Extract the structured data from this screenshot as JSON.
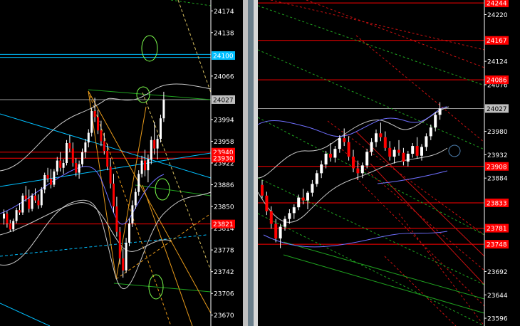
{
  "colors": {
    "background": "#000000",
    "bull_candle": "#ffffff",
    "bear_candle": "#ff0000",
    "wick": "#ffffff",
    "axis_text": "#ffffff",
    "price_line": "#ffffff",
    "level_line": "#ff0000",
    "label_red": "#ff0000",
    "label_cyan": "#00bfff",
    "label_gray": "#bfbfbf",
    "ma": "#6f6fff",
    "envelope": "#c8c8c8",
    "cyan_line": "#00bfff",
    "green_line": "#1fa31f",
    "orange_line": "#e89a1a",
    "yellow_line": "#d8c060",
    "circle": "#7cfc4c"
  },
  "chart_data": [
    {
      "type": "candlestick",
      "ylim": [
        23652,
        24192
      ],
      "y_ticks": [
        "24174",
        "24138",
        "24066",
        "23994",
        "23958",
        "23922",
        "23886",
        "23850",
        "23814",
        "23778",
        "23742",
        "23706",
        "23670"
      ],
      "price_labels": [
        {
          "text": "24100",
          "value": 24100,
          "color": "cyan"
        },
        {
          "text": "24027",
          "value": 24027,
          "color": "gray"
        },
        {
          "text": "23940",
          "value": 23940,
          "color": "red"
        },
        {
          "text": "23930",
          "value": 23930,
          "color": "red"
        },
        {
          "text": "23821",
          "value": 23821,
          "color": "red"
        }
      ],
      "current_price": 24027,
      "red_levels": [
        23940,
        23930,
        23821
      ],
      "candles": [
        [
          23830,
          23845,
          23820,
          23838
        ],
        [
          23838,
          23842,
          23815,
          23822
        ],
        [
          23822,
          23828,
          23808,
          23812
        ],
        [
          23812,
          23830,
          23808,
          23826
        ],
        [
          23826,
          23848,
          23822,
          23844
        ],
        [
          23844,
          23856,
          23836,
          23840
        ],
        [
          23840,
          23872,
          23836,
          23868
        ],
        [
          23868,
          23884,
          23858,
          23862
        ],
        [
          23862,
          23878,
          23840,
          23846
        ],
        [
          23846,
          23872,
          23842,
          23868
        ],
        [
          23868,
          23880,
          23856,
          23860
        ],
        [
          23860,
          23870,
          23846,
          23852
        ],
        [
          23852,
          23882,
          23848,
          23878
        ],
        [
          23878,
          23906,
          23872,
          23902
        ],
        [
          23902,
          23914,
          23890,
          23896
        ],
        [
          23896,
          23912,
          23880,
          23886
        ],
        [
          23886,
          23912,
          23882,
          23908
        ],
        [
          23908,
          23932,
          23902,
          23926
        ],
        [
          23926,
          23940,
          23908,
          23914
        ],
        [
          23914,
          23928,
          23904,
          23922
        ],
        [
          23922,
          23960,
          23918,
          23955
        ],
        [
          23955,
          23968,
          23940,
          23946
        ],
        [
          23946,
          23956,
          23916,
          23922
        ],
        [
          23922,
          23930,
          23900,
          23906
        ],
        [
          23906,
          23926,
          23896,
          23920
        ],
        [
          23920,
          23946,
          23916,
          23940
        ],
        [
          23940,
          23962,
          23930,
          23956
        ],
        [
          23956,
          23978,
          23948,
          23972
        ],
        [
          23972,
          24014,
          23966,
          24008
        ],
        [
          24008,
          24030,
          23990,
          23998
        ],
        [
          23998,
          24010,
          23970,
          23976
        ],
        [
          23976,
          23992,
          23950,
          23958
        ],
        [
          23958,
          23972,
          23936,
          23942
        ],
        [
          23942,
          23954,
          23910,
          23916
        ],
        [
          23916,
          23930,
          23880,
          23888
        ],
        [
          23888,
          23904,
          23840,
          23850
        ],
        [
          23850,
          23866,
          23800,
          23808
        ],
        [
          23808,
          23816,
          23754,
          23764
        ],
        [
          23764,
          23780,
          23732,
          23744
        ],
        [
          23744,
          23798,
          23740,
          23790
        ],
        [
          23790,
          23830,
          23784,
          23822
        ],
        [
          23822,
          23860,
          23816,
          23852
        ],
        [
          23852,
          23880,
          23846,
          23874
        ],
        [
          23874,
          23910,
          23868,
          23904
        ],
        [
          23904,
          23934,
          23898,
          23926
        ],
        [
          23926,
          23944,
          23900,
          23910
        ],
        [
          23910,
          23936,
          23890,
          23928
        ],
        [
          23928,
          23966,
          23920,
          23960
        ],
        [
          23960,
          23990,
          23936,
          23946
        ],
        [
          23946,
          23968,
          23928,
          23962
        ],
        [
          23962,
          24002,
          23956,
          23996
        ],
        [
          23996,
          24040,
          23990,
          24027
        ]
      ]
    },
    {
      "type": "candlestick",
      "ylim": [
        23580,
        24250
      ],
      "y_ticks": [
        "24220",
        "24124",
        "24076",
        "23980",
        "23932",
        "23884",
        "23692",
        "23644",
        "23596"
      ],
      "price_labels": [
        {
          "text": "24244",
          "value": 24244,
          "color": "red"
        },
        {
          "text": "24167",
          "value": 24167,
          "color": "red"
        },
        {
          "text": "24086",
          "value": 24086,
          "color": "red"
        },
        {
          "text": "24027",
          "value": 24027,
          "color": "gray"
        },
        {
          "text": "23908",
          "value": 23908,
          "color": "red"
        },
        {
          "text": "23833",
          "value": 23833,
          "color": "red"
        },
        {
          "text": "23781",
          "value": 23781,
          "color": "red"
        },
        {
          "text": "23748",
          "value": 23748,
          "color": "red"
        }
      ],
      "current_price": 24027,
      "red_levels": [
        24244,
        24167,
        24086,
        23908,
        23833,
        23781,
        23748
      ],
      "candles": [
        [
          23870,
          23880,
          23842,
          23848
        ],
        [
          23848,
          23856,
          23808,
          23816
        ],
        [
          23816,
          23826,
          23780,
          23790
        ],
        [
          23790,
          23800,
          23752,
          23760
        ],
        [
          23760,
          23790,
          23740,
          23784
        ],
        [
          23784,
          23806,
          23776,
          23800
        ],
        [
          23800,
          23820,
          23790,
          23812
        ],
        [
          23812,
          23830,
          23800,
          23824
        ],
        [
          23824,
          23850,
          23818,
          23844
        ],
        [
          23844,
          23862,
          23830,
          23838
        ],
        [
          23838,
          23858,
          23820,
          23854
        ],
        [
          23854,
          23880,
          23846,
          23872
        ],
        [
          23872,
          23900,
          23866,
          23894
        ],
        [
          23894,
          23920,
          23884,
          23912
        ],
        [
          23912,
          23940,
          23904,
          23934
        ],
        [
          23934,
          23956,
          23918,
          23926
        ],
        [
          23926,
          23950,
          23916,
          23944
        ],
        [
          23944,
          23972,
          23936,
          23966
        ],
        [
          23966,
          23986,
          23950,
          23958
        ],
        [
          23958,
          23970,
          23920,
          23928
        ],
        [
          23928,
          23942,
          23896,
          23904
        ],
        [
          23904,
          23920,
          23880,
          23894
        ],
        [
          23894,
          23916,
          23884,
          23910
        ],
        [
          23910,
          23944,
          23904,
          23938
        ],
        [
          23938,
          23966,
          23930,
          23958
        ],
        [
          23958,
          23984,
          23948,
          23976
        ],
        [
          23976,
          23998,
          23960,
          23968
        ],
        [
          23968,
          23980,
          23940,
          23946
        ],
        [
          23946,
          23960,
          23920,
          23928
        ],
        [
          23928,
          23948,
          23914,
          23942
        ],
        [
          23942,
          23962,
          23930,
          23936
        ],
        [
          23936,
          23946,
          23910,
          23918
        ],
        [
          23918,
          23940,
          23908,
          23934
        ],
        [
          23934,
          23956,
          23926,
          23950
        ],
        [
          23950,
          23968,
          23924,
          23930
        ],
        [
          23930,
          23954,
          23920,
          23948
        ],
        [
          23948,
          23976,
          23940,
          23970
        ],
        [
          23970,
          23994,
          23962,
          23988
        ],
        [
          23988,
          24020,
          23980,
          24014
        ],
        [
          24014,
          24040,
          24004,
          24027
        ]
      ]
    }
  ]
}
